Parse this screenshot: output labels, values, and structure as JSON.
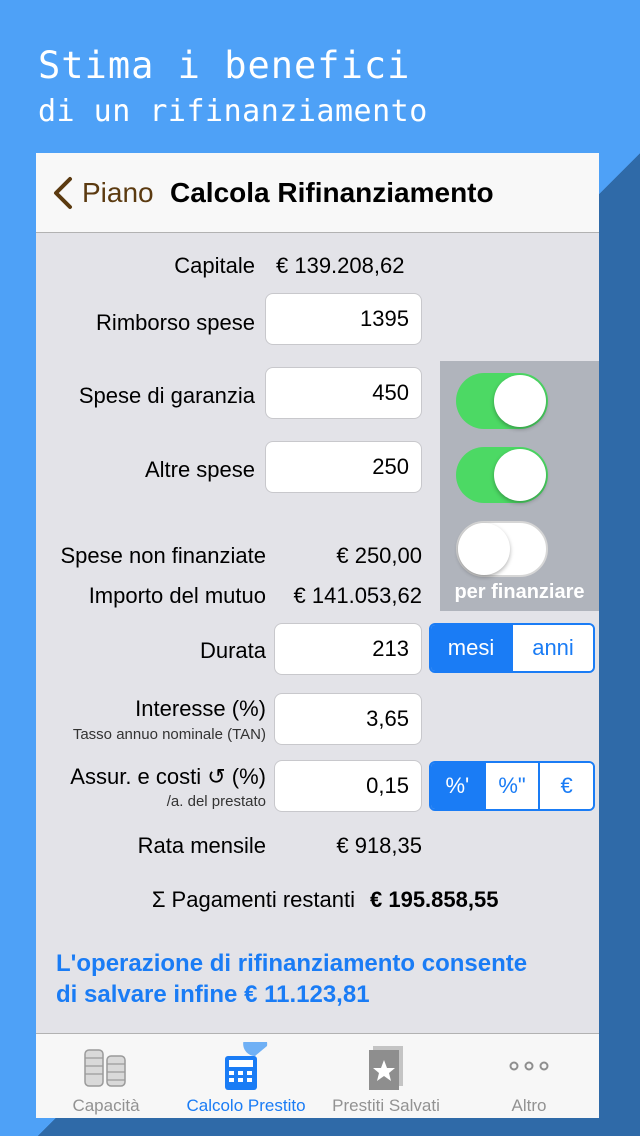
{
  "promo": {
    "line1": "Stima i benefici",
    "line2": "di un rifinanziamento"
  },
  "nav": {
    "back_label": "Piano",
    "title": "Calcola Rifinanziamento"
  },
  "form": {
    "capitale": {
      "label": "Capitale",
      "value": "€ 139.208,62"
    },
    "rimborso_spese": {
      "label": "Rimborso spese",
      "value": "1395",
      "financed": true
    },
    "spese_garanzia": {
      "label": "Spese di garanzia",
      "value": "450",
      "financed": true
    },
    "altre_spese": {
      "label": "Altre spese",
      "value": "250",
      "financed": false
    },
    "toggle_caption": "per finanziare",
    "spese_non_finanziate": {
      "label": "Spese non finanziate",
      "value": "€ 250,00"
    },
    "importo_mutuo": {
      "label": "Importo del mutuo",
      "value": "€ 141.053,62"
    },
    "durata": {
      "label": "Durata",
      "value": "213",
      "units": [
        "mesi",
        "anni"
      ],
      "selected_unit": "mesi"
    },
    "interesse": {
      "label": "Interesse (%)",
      "sublabel": "Tasso annuo nominale (TAN)",
      "value": "3,65"
    },
    "assicurazione": {
      "label": "Assur. e costi ↺ (%)",
      "sublabel": "/a. del prestato",
      "value": "0,15",
      "units": [
        "%'",
        "%\"",
        "€"
      ],
      "selected_unit": "%'"
    },
    "rata_mensile": {
      "label": "Rata mensile",
      "value": "€ 918,35"
    },
    "pagamenti_restanti": {
      "label": "Σ Pagamenti restanti",
      "value": "€ 195.858,55"
    }
  },
  "savings_message": {
    "line1": "L'operazione di rifinanziamento consente",
    "line2": "di salvare infine € 11.123,81"
  },
  "tabs": [
    {
      "label": "Capacità",
      "icon": "coins-icon",
      "active": false
    },
    {
      "label": "Calcolo Prestito",
      "icon": "calculator-icon",
      "active": true
    },
    {
      "label": "Prestiti Salvati",
      "icon": "saved-star-icon",
      "active": false
    },
    {
      "label": "Altro",
      "icon": "more-icon",
      "active": false
    }
  ],
  "colors": {
    "background": "#4ea1f7",
    "accent": "#1a7cf5",
    "switch_on": "#4cd964",
    "back_label": "#5b3a10"
  }
}
